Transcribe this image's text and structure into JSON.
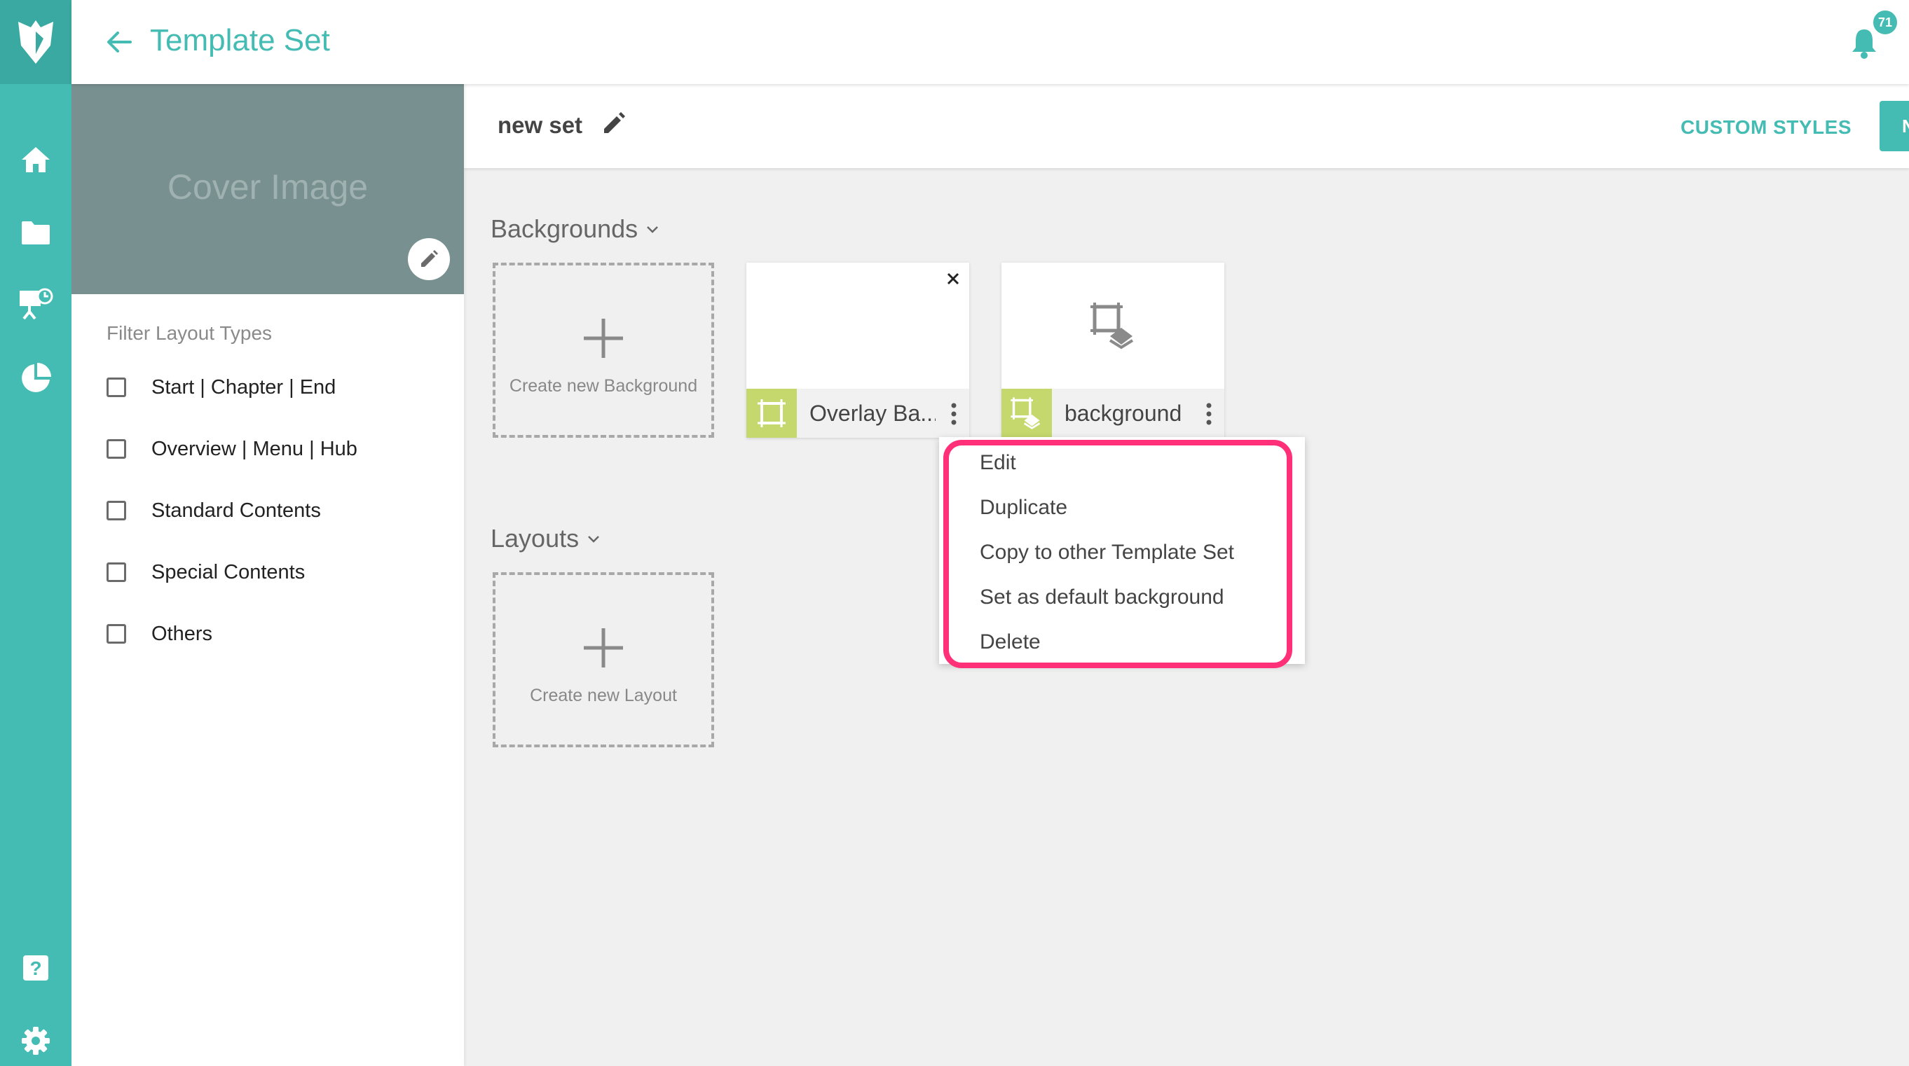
{
  "app": {
    "title": "Template Set",
    "notification_count": "71"
  },
  "rail": {
    "icons": [
      "logo-icon",
      "home-icon",
      "folder-icon",
      "presentation-icon",
      "pie-chart-icon",
      "help-icon",
      "gear-icon"
    ]
  },
  "cover": {
    "label": "Cover Image"
  },
  "filter": {
    "heading": "Filter Layout Types",
    "items": [
      {
        "label": "Start | Chapter | End"
      },
      {
        "label": "Overview | Menu | Hub"
      },
      {
        "label": "Standard Contents"
      },
      {
        "label": "Special Contents"
      },
      {
        "label": "Others"
      }
    ]
  },
  "set": {
    "name": "new set",
    "custom_styles_label": "CUSTOM STYLES",
    "new_button_label": "N"
  },
  "backgrounds": {
    "heading": "Backgrounds",
    "create_label": "Create new Background",
    "cards": [
      {
        "name": "Overlay Ba..."
      },
      {
        "name": "background"
      }
    ]
  },
  "layouts": {
    "heading": "Layouts",
    "create_label": "Create new Layout"
  },
  "context_menu": {
    "items": [
      {
        "label": "Edit"
      },
      {
        "label": "Duplicate"
      },
      {
        "label": "Copy to other Template Set"
      },
      {
        "label": "Set as default background"
      },
      {
        "label": "Delete"
      }
    ]
  },
  "colors": {
    "accent": "#45bcb3",
    "highlight": "#ff2f78",
    "background_type": "#c5d86d"
  }
}
